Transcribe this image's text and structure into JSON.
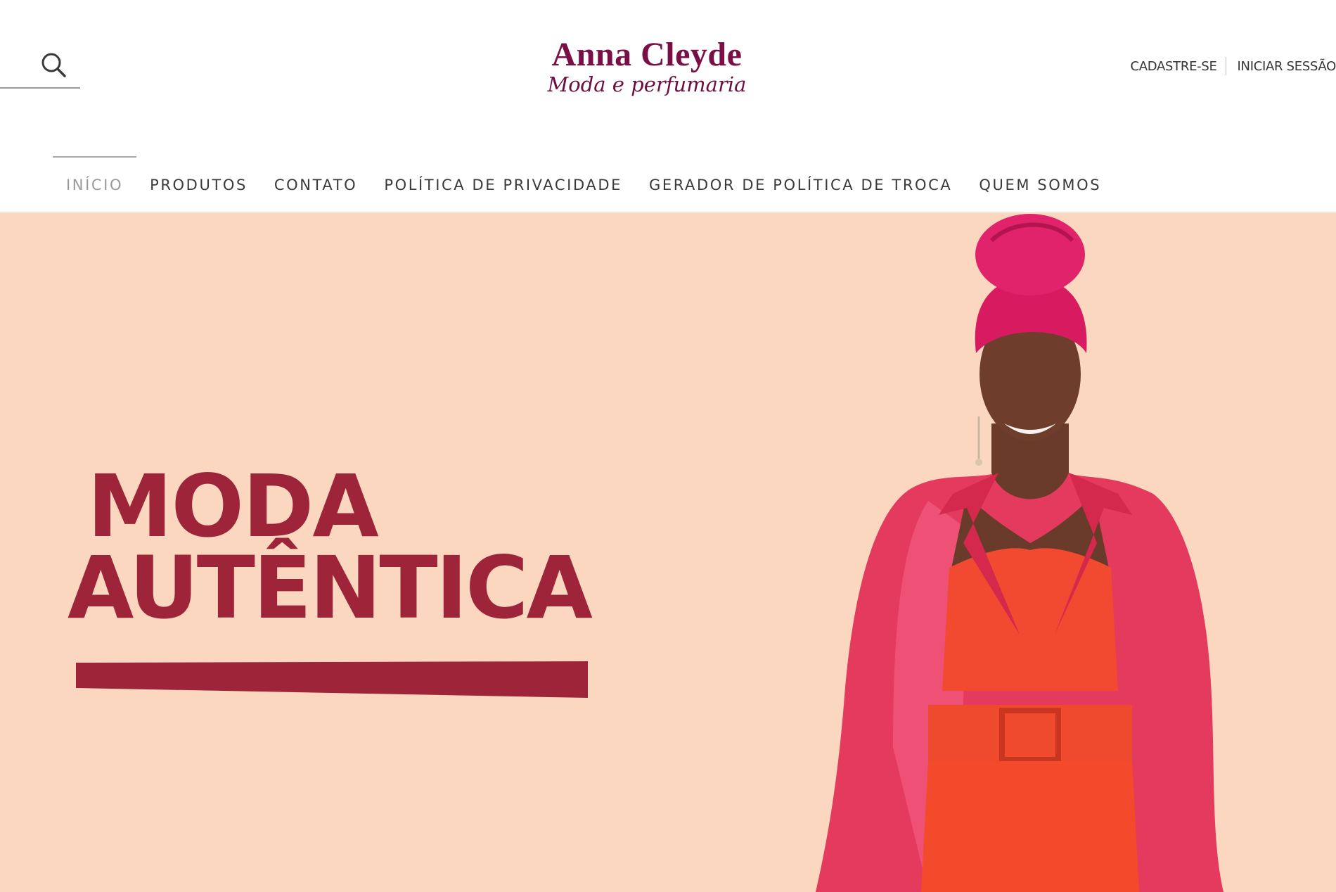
{
  "header": {
    "search_icon": "search-icon",
    "logo": {
      "title": "Anna Cleyde",
      "subtitle": "Moda e perfumaria"
    },
    "account": {
      "signup_label": "CADASTRE-SE",
      "login_label": "INICIAR SESSÃO"
    }
  },
  "nav": {
    "items": [
      {
        "label": "INÍCIO",
        "active": true
      },
      {
        "label": "PRODUTOS",
        "active": false
      },
      {
        "label": "CONTATO",
        "active": false
      },
      {
        "label": "POLÍTICA DE PRIVACIDADE",
        "active": false
      },
      {
        "label": "GERADOR DE POLÍTICA DE TROCA",
        "active": false
      },
      {
        "label": "QUEM SOMOS",
        "active": false
      }
    ]
  },
  "hero": {
    "line1": "MODA",
    "line2": "AUTÊNTICA",
    "colors": {
      "background": "#fbd7c0",
      "headline": "#9e2439"
    }
  },
  "colors": {
    "brand": "#7a0f45"
  }
}
